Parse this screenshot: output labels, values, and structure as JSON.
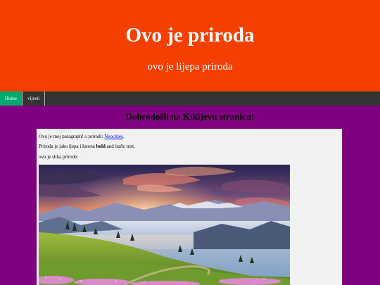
{
  "header": {
    "title": "Ovo je priroda",
    "subtitle": "ovo je lijepa priroda"
  },
  "nav": {
    "items": [
      {
        "label": "Home",
        "active": true
      },
      {
        "label": "vijesti",
        "active": false
      }
    ]
  },
  "main": {
    "heading": "Dobrodošli na Kikijevu stranicu!",
    "para1_text": "Ovo je moj paragraph! o prirodi: ",
    "para1_link": "Neocities",
    "para1_end": ".",
    "para2_start": "Priroda je jako ljepa i šarena ",
    "para2_bold": "bold",
    "para2_mid": " and ",
    "para2_italic": "italic",
    "para2_end": " text.",
    "para3": "ovo je slika prirode:"
  },
  "colors": {
    "header_bg": "#f33f00",
    "nav_bg": "#333333",
    "nav_active": "#04aa6d",
    "page_bg": "#800080",
    "content_bg": "#f1f1f1"
  }
}
